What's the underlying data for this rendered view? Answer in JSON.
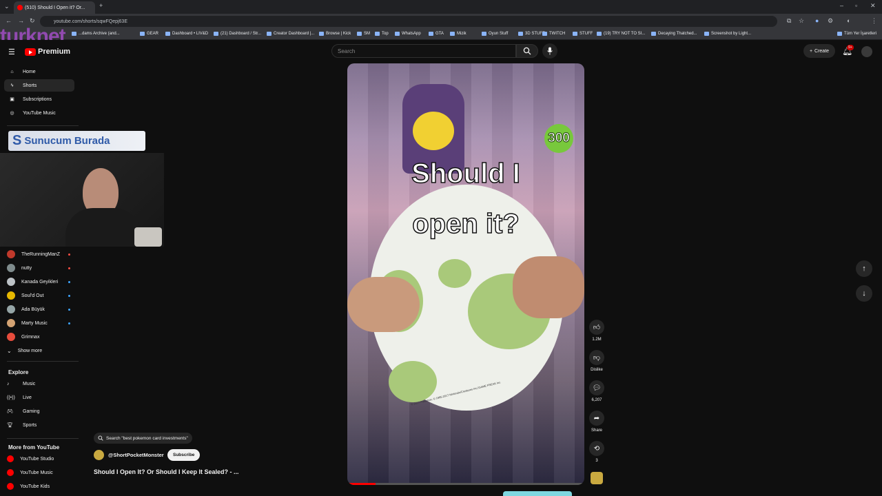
{
  "browser": {
    "tab_title": "(510) Should I Open it? Or...",
    "url": "youtube.com/shorts/sqwFQepj63E",
    "bookmarks": [
      "...dams Archive (and...",
      "GEAR",
      "Dashboard • LIV&D",
      "(21) Dashboard / Str...",
      "Creator Dashboard |...",
      "Browse | Kick",
      "SM",
      "Top",
      "WhatsApp",
      "GTA",
      "Mizik",
      "Oyun Stuff",
      "3D STUFF",
      "TWITCH",
      "STUFF",
      "(19) TRY NOT TO SI...",
      "Decaying Thatched...",
      "Screenshot by Light...",
      "Tüm Yer İşaretleri"
    ]
  },
  "overlays": {
    "turknet_logo": "turknet",
    "banner": "Sunucum Burada"
  },
  "header": {
    "logo_text": "Premium",
    "search_placeholder": "Search",
    "create_label": "Create",
    "notification_count": "9+"
  },
  "sidebar": {
    "main": [
      {
        "label": "Home",
        "icon": "home-icon"
      },
      {
        "label": "Shorts",
        "icon": "shorts-icon"
      },
      {
        "label": "Subscriptions",
        "icon": "subscriptions-icon"
      },
      {
        "label": "YouTube Music",
        "icon": "music-icon"
      }
    ],
    "subscriptions": [
      {
        "label": "TheRunningManZ",
        "color": "#c0392b"
      },
      {
        "label": "nutty",
        "color": "#7f8c8d"
      },
      {
        "label": "Kanada Geyikleri",
        "color": "#bdc3c7"
      },
      {
        "label": "Soul'd Out",
        "color": "#e6b800"
      },
      {
        "label": "Ada Büyük",
        "color": "#95a5a6"
      },
      {
        "label": "Marty Music",
        "color": "#d4a373"
      },
      {
        "label": "Grimnax",
        "color": "#e74c3c"
      }
    ],
    "show_more": "Show more",
    "explore_title": "Explore",
    "explore": [
      {
        "label": "Music"
      },
      {
        "label": "Live"
      },
      {
        "label": "Gaming"
      },
      {
        "label": "Sports"
      }
    ],
    "more_title": "More from YouTube",
    "more": [
      {
        "label": "YouTube Studio"
      },
      {
        "label": "YouTube Music"
      },
      {
        "label": "YouTube Kids"
      }
    ]
  },
  "short": {
    "caption_line1": "Should I",
    "caption_line2": "open it?",
    "badge": "300",
    "card_text": "© 2017 Pokémon. © 1995-2017 Nintendo/Creatures Inc./GAME FREAK inc.",
    "search_suggestion": "Search \"best pokemon card investments\"",
    "channel": "@ShortPocketMonster",
    "subscribe_label": "Subscribe",
    "title": "Should I Open It? Or Should I Keep It Sealed? - ..."
  },
  "actions": {
    "likes": "1.2M",
    "dislike_label": "Dislike",
    "comments": "6,207",
    "share_label": "Share",
    "remix": "3"
  },
  "colors": {
    "accent": "#ff0000",
    "background": "#0f0f0f"
  }
}
